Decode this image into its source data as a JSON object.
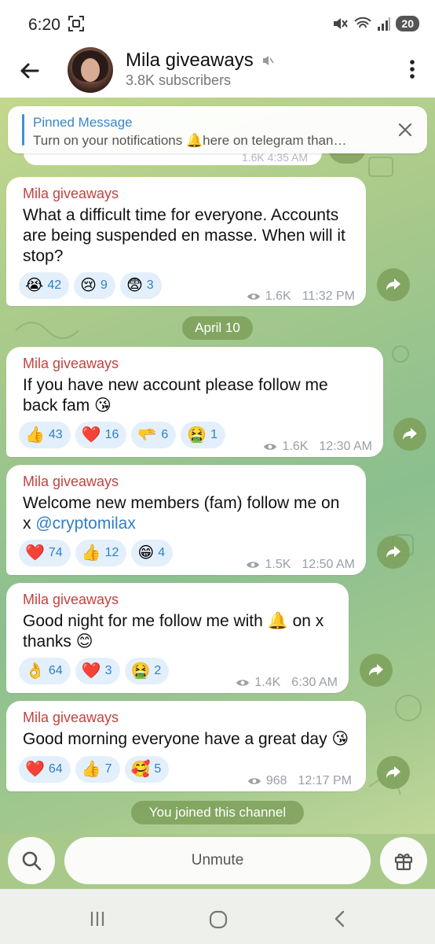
{
  "status_bar": {
    "time": "6:20",
    "battery": "20"
  },
  "header": {
    "title": "Mila giveaways",
    "subtitle": "3.8K subscribers"
  },
  "pinned": {
    "label": "Pinned Message",
    "text": "Turn on your notifications 🔔here on telegram than…"
  },
  "previous_meta": "1.6K  4:35 AM",
  "date_divider": "April 10",
  "messages": [
    {
      "sender": "Mila giveaways",
      "lines": [
        "What a difficult time for everyone. Accounts",
        "are being suspended en masse. When will it",
        "stop?"
      ],
      "reactions": [
        {
          "emoji": "😭",
          "count": "42"
        },
        {
          "emoji": "😢",
          "count": "9"
        },
        {
          "emoji": "😨",
          "count": "3"
        }
      ],
      "views": "1.6K",
      "time": "11:32 PM"
    },
    {
      "sender": "Mila giveaways",
      "lines": [
        "If you have new account please follow me",
        "back fam 😘"
      ],
      "reactions": [
        {
          "emoji": "👍",
          "count": "43"
        },
        {
          "emoji": "❤️",
          "count": "16"
        },
        {
          "emoji": "🫳",
          "count": "6"
        },
        {
          "emoji": "🤮",
          "count": "1"
        }
      ],
      "views": "1.6K",
      "time": "12:30 AM"
    },
    {
      "sender": "Mila giveaways",
      "lines": [
        "Welcome new members (fam) follow me on",
        "x "
      ],
      "link": "@cryptomilax",
      "reactions": [
        {
          "emoji": "❤️",
          "count": "74"
        },
        {
          "emoji": "👍",
          "count": "12"
        },
        {
          "emoji": "😁",
          "count": "4"
        }
      ],
      "views": "1.5K",
      "time": "12:50 AM"
    },
    {
      "sender": "Mila giveaways",
      "lines": [
        "Good night for me follow me with 🔔 on x",
        "thanks 😊"
      ],
      "reactions": [
        {
          "emoji": "👌",
          "count": "64"
        },
        {
          "emoji": "❤️",
          "count": "3"
        },
        {
          "emoji": "🤮",
          "count": "2"
        }
      ],
      "views": "1.4K",
      "time": "6:30 AM"
    },
    {
      "sender": "Mila giveaways",
      "lines": [
        "Good morning everyone have a great day 😘"
      ],
      "reactions": [
        {
          "emoji": "❤️",
          "count": "64"
        },
        {
          "emoji": "👍",
          "count": "7"
        },
        {
          "emoji": "🥰",
          "count": "5"
        }
      ],
      "views": "968",
      "time": "12:17 PM"
    }
  ],
  "joined_notice": "You joined this channel",
  "bottom": {
    "unmute_label": "Unmute"
  },
  "colors": {
    "sender": "#c2433f",
    "link": "#2f7fc6",
    "accent": "#3a86cc",
    "reaction_bg": "#e3f0fb"
  }
}
